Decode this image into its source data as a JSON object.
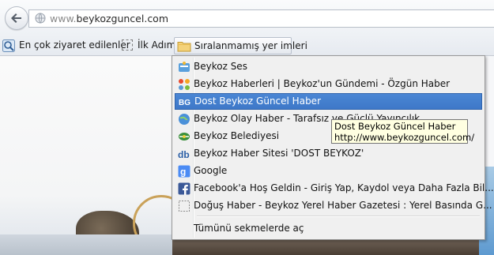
{
  "navbar": {
    "url_prefix": "www.",
    "url_domain": "beykozguncel.com"
  },
  "bookmarks_toolbar": {
    "items": [
      {
        "label": "En çok ziyaret edilenler",
        "icon": "most-visited-icon"
      },
      {
        "label": "İlk Adım",
        "icon": "separator-icon"
      },
      {
        "label": "Sıralanmamış yer imleri",
        "icon": "folder-icon"
      }
    ]
  },
  "menu": {
    "items": [
      {
        "label": "Beykoz Ses",
        "icon": "beykoz-ses-favicon"
      },
      {
        "label": "Beykoz Haberleri | Beykoz'un Gündemi - Özgün Haber",
        "icon": "joomla-favicon"
      },
      {
        "label": "Dost Beykoz Güncel Haber",
        "icon": "bg-favicon",
        "highlighted": true
      },
      {
        "label": "Beykoz Olay Haber - Tarafsız ve Güclü Yayıncılık",
        "icon": "globe-favicon"
      },
      {
        "label": "Beykoz Belediyesi",
        "icon": "belediye-favicon"
      },
      {
        "label": "Beykoz Haber Sitesi 'DOST BEYKOZ'",
        "icon": "db-favicon"
      },
      {
        "label": "Google",
        "icon": "google-favicon"
      },
      {
        "label": "Facebook'a Hoş Geldin - Giriş Yap, Kaydol veya Daha Fazla Bil...",
        "icon": "facebook-favicon"
      },
      {
        "label": "Doğuş Haber - Beykoz Yerel Haber Gazetesi : Yerel Basında G...",
        "icon": "blank-page-favicon"
      }
    ],
    "open_all": "Tümünü sekmelerde aç"
  },
  "tooltip": {
    "title": "Dost Beykoz Güncel Haber",
    "url": "http://www.beykozguncel.com/"
  },
  "colors": {
    "highlight": "#3e78c8",
    "tooltip_bg": "#ffffe1",
    "menu_bg": "#f0f0f0"
  }
}
